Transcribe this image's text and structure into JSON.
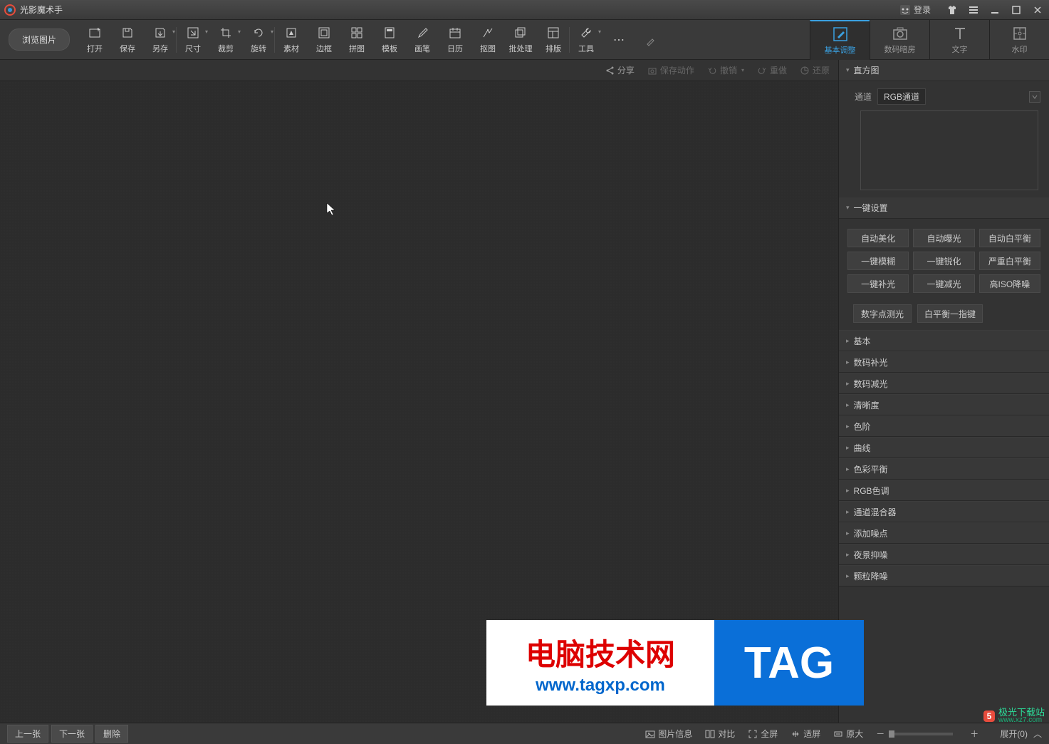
{
  "titlebar": {
    "app_name": "光影魔术手",
    "login": "登录"
  },
  "toolbar": {
    "browse": "浏览图片",
    "items": [
      {
        "label": "打开"
      },
      {
        "label": "保存"
      },
      {
        "label": "另存"
      },
      {
        "label": "尺寸"
      },
      {
        "label": "裁剪"
      },
      {
        "label": "旋转"
      },
      {
        "label": "素材"
      },
      {
        "label": "边框"
      },
      {
        "label": "拼图"
      },
      {
        "label": "模板"
      },
      {
        "label": "画笔"
      },
      {
        "label": "日历"
      },
      {
        "label": "抠图"
      },
      {
        "label": "批处理"
      },
      {
        "label": "排版"
      },
      {
        "label": "工具"
      }
    ]
  },
  "right_tabs": [
    {
      "label": "基本调整"
    },
    {
      "label": "数码暗房"
    },
    {
      "label": "文字"
    },
    {
      "label": "水印"
    }
  ],
  "actionbar": {
    "share": "分享",
    "save_action": "保存动作",
    "undo": "撤销",
    "redo": "重做",
    "restore": "还原"
  },
  "panel": {
    "histogram": {
      "title": "直方图",
      "channel_label": "通道",
      "channel_value": "RGB通道"
    },
    "onekey": {
      "title": "一键设置",
      "buttons": [
        "自动美化",
        "自动曝光",
        "自动白平衡",
        "一键模糊",
        "一键锐化",
        "严重白平衡",
        "一键补光",
        "一键减光",
        "高ISO降噪"
      ],
      "extra": [
        "数字点测光",
        "白平衡一指键"
      ]
    },
    "collapsed": [
      "基本",
      "数码补光",
      "数码减光",
      "清晰度",
      "色阶",
      "曲线",
      "色彩平衡",
      "RGB色调",
      "通道混合器",
      "添加噪点",
      "夜景抑噪",
      "颗粒降噪"
    ]
  },
  "bottombar": {
    "prev": "上一张",
    "next": "下一张",
    "delete": "删除",
    "image_info": "图片信息",
    "compare": "对比",
    "fullscreen": "全屏",
    "fit_screen": "适屏",
    "original": "原大",
    "expand": "展开(0)"
  },
  "watermark": {
    "line1": "电脑技术网",
    "line2": "www.tagxp.com",
    "tag": "TAG",
    "site": "极光下载站",
    "url": "www.xz7.com"
  }
}
